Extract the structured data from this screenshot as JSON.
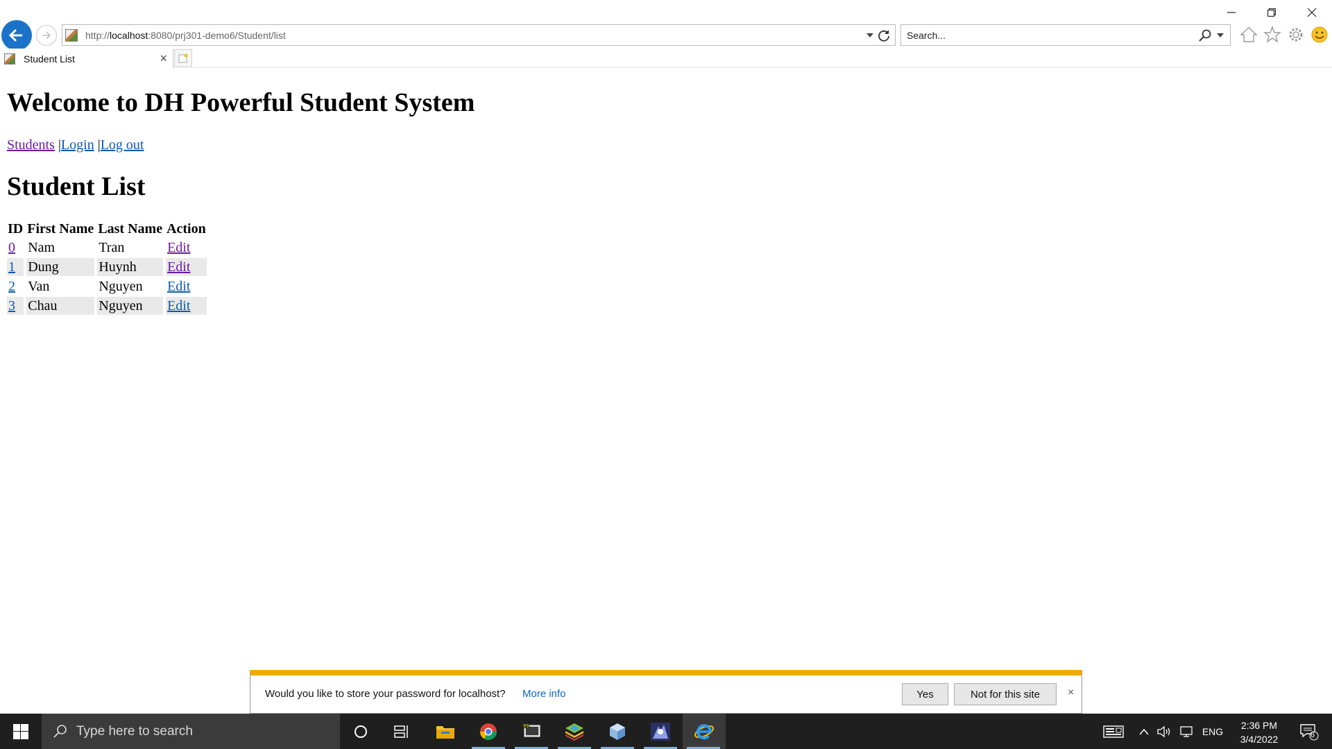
{
  "browser": {
    "address": {
      "prefix": "http://",
      "host": "localhost",
      "rest": ":8080/prj301-demo6/Student/list"
    },
    "search_placeholder": "Search...",
    "tab_title": "Student List",
    "tab_close": "×"
  },
  "page": {
    "heading": "Welcome to DH Powerful Student System",
    "nav": {
      "students": "Students",
      "sep1": " |",
      "login": "Login",
      "sep2": " |",
      "logout": "Log out"
    },
    "list_title": "Student List",
    "table": {
      "headers": [
        "ID",
        "First Name",
        "Last Name",
        "Action"
      ],
      "rows": [
        {
          "id": "0",
          "first": "Nam",
          "last": "Tran",
          "action": "Edit"
        },
        {
          "id": "1",
          "first": "Dung",
          "last": "Huynh",
          "action": "Edit"
        },
        {
          "id": "2",
          "first": "Van",
          "last": "Nguyen",
          "action": "Edit"
        },
        {
          "id": "3",
          "first": "Chau",
          "last": "Nguyen",
          "action": "Edit"
        }
      ]
    }
  },
  "notification": {
    "message": "Would you like to store your password for localhost?",
    "more_info": "More info",
    "yes": "Yes",
    "no": "Not for this site",
    "close": "×"
  },
  "taskbar": {
    "search_placeholder": "Type here to search",
    "language": "ENG",
    "time": "2:36 PM",
    "date": "3/4/2022",
    "notification_count": "6"
  },
  "colors": {
    "link": "#0b59b5",
    "visited_link": "#6b1aa0",
    "notification_accent": "#f0ab00",
    "back_button": "#1a73c8",
    "taskbar": "#1f1f1f"
  }
}
